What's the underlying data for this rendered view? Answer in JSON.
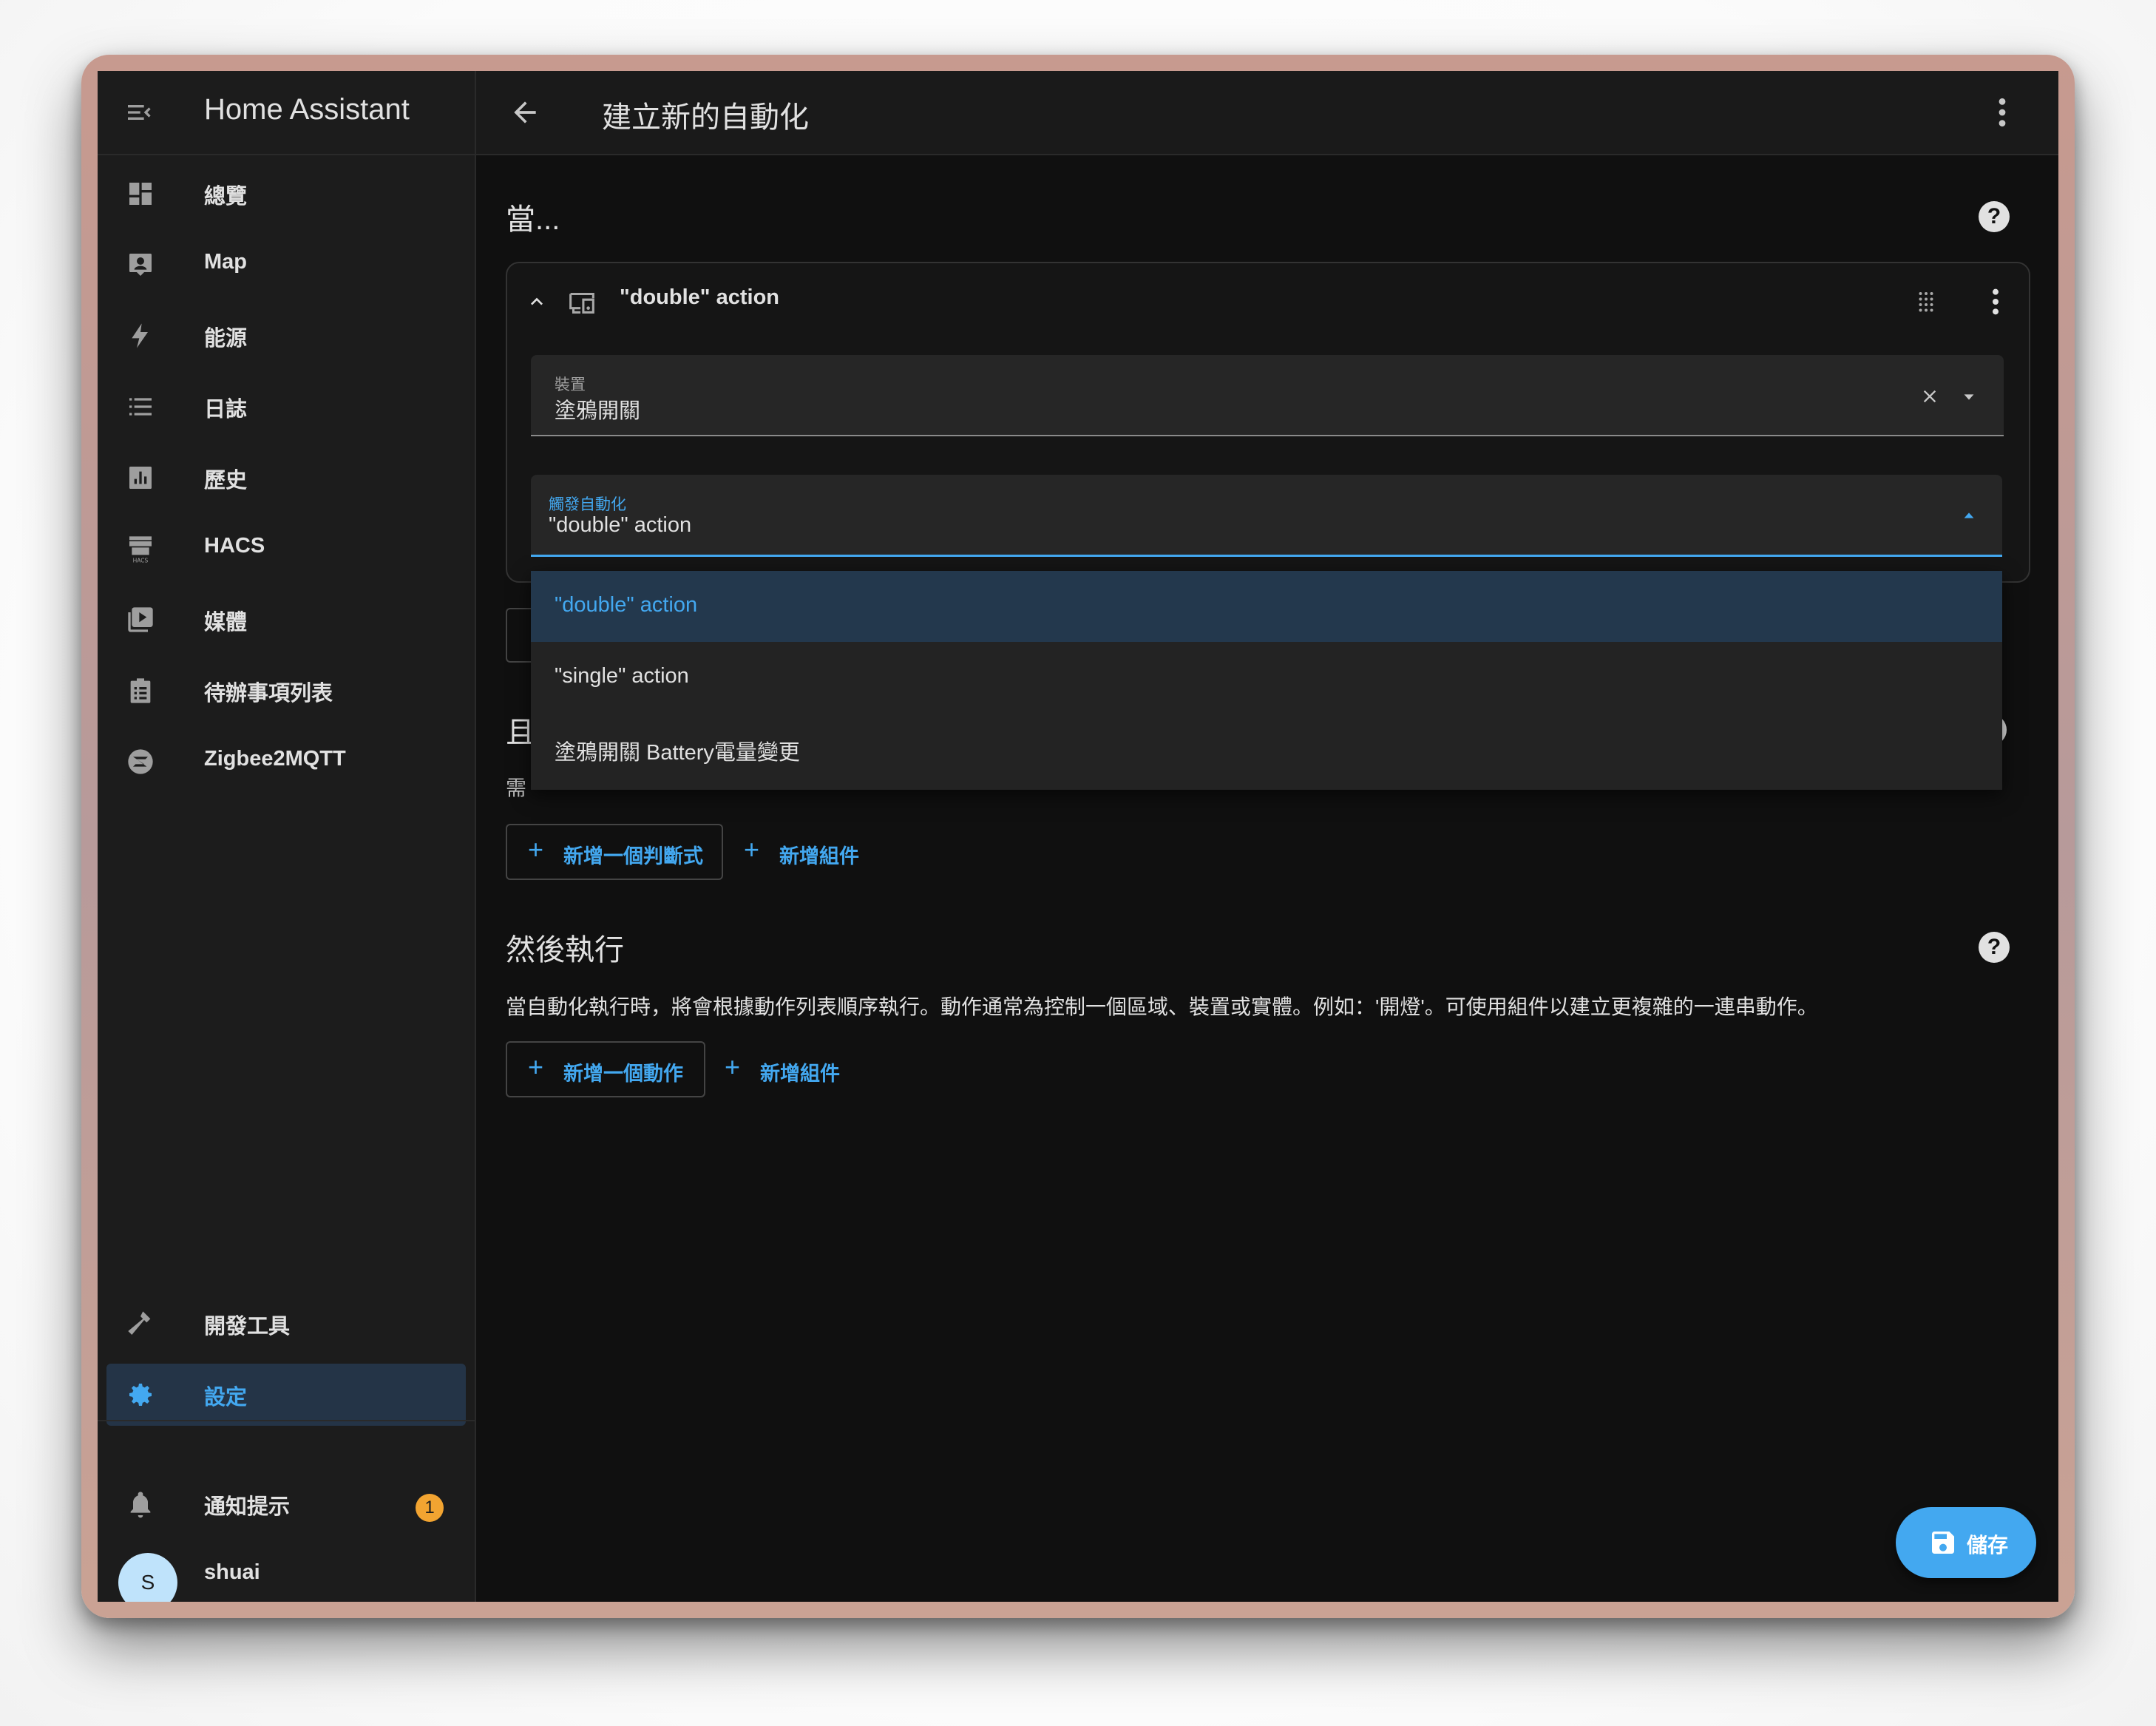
{
  "app": {
    "title": "Home Assistant"
  },
  "sidebar": {
    "items": [
      {
        "label": "總覽",
        "icon": "dashboard-icon"
      },
      {
        "label": "Map",
        "icon": "map-account-icon"
      },
      {
        "label": "能源",
        "icon": "lightning-icon"
      },
      {
        "label": "日誌",
        "icon": "list-icon"
      },
      {
        "label": "歷史",
        "icon": "chart-box-icon"
      },
      {
        "label": "HACS",
        "icon": "hacs-store-icon"
      },
      {
        "label": "媒體",
        "icon": "media-play-icon"
      },
      {
        "label": "待辦事項列表",
        "icon": "clipboard-list-icon"
      },
      {
        "label": "Zigbee2MQTT",
        "icon": "zigbee-icon"
      }
    ],
    "bottom": [
      {
        "label": "開發工具",
        "icon": "hammer-icon"
      },
      {
        "label": "設定",
        "icon": "gear-icon",
        "active": true
      }
    ],
    "notifications": {
      "label": "通知提示",
      "count": "1"
    },
    "user": {
      "name": "shuai",
      "initial": "S"
    }
  },
  "header": {
    "title": "建立新的自動化"
  },
  "triggers": {
    "heading": "當...",
    "card": {
      "title": "\"double\" action",
      "device_field": {
        "label": "裝置",
        "value": "塗鴉開關"
      },
      "trigger_field": {
        "label": "觸發自動化",
        "value": "\"double\" action"
      }
    },
    "dropdown_options": [
      "\"double\" action",
      "\"single\" action",
      "塗鴉開關 Battery電量變更"
    ]
  },
  "conditions": {
    "heading_partial": "且",
    "description_partial": "需",
    "add_condition": "新增一個判斷式",
    "add_block": "新增組件"
  },
  "actions": {
    "heading": "然後執行",
    "description": "當自動化執行時，將會根據動作列表順序執行。動作通常為控制一個區域、裝置或實體。例如：'開燈'。可使用組件以建立更複雜的一連串動作。",
    "add_action": "新增一個動作",
    "add_block": "新增組件"
  },
  "save_label": "儲存",
  "colors": {
    "accent": "#43a8f0",
    "badge": "#f2a431",
    "sidebar": "#1c1c1c",
    "background": "#101010"
  }
}
